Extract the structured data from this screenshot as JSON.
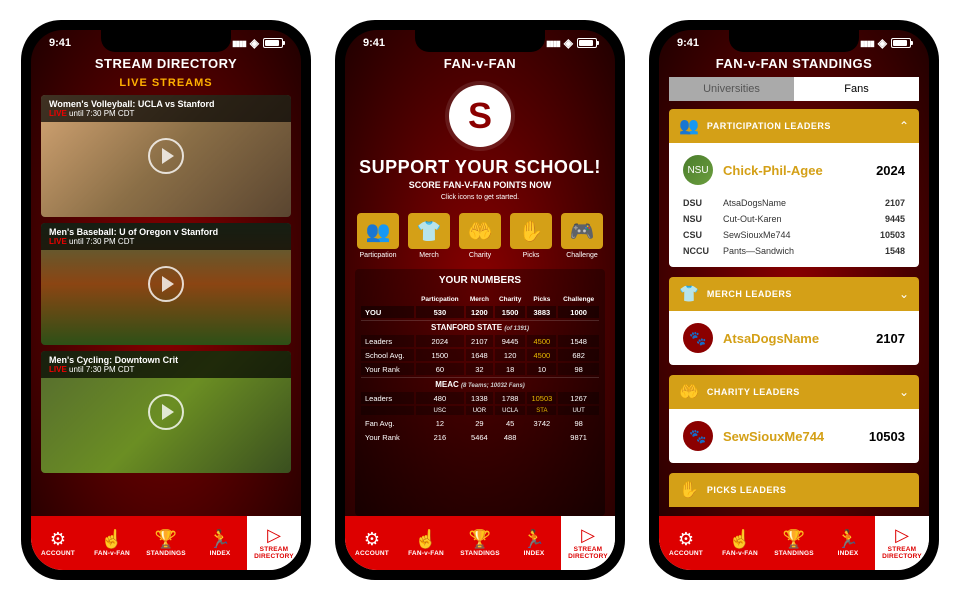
{
  "status": {
    "time": "9:41"
  },
  "nav": {
    "items": [
      {
        "label": "ACCOUNT",
        "icon": "⚙"
      },
      {
        "label": "FAN-v-FAN",
        "icon": "☝"
      },
      {
        "label": "STANDINGS",
        "icon": "🏆"
      },
      {
        "label": "INDEX",
        "icon": "🏃"
      },
      {
        "label": "STREAM\nDIRECTORY",
        "icon": "▷"
      }
    ]
  },
  "phone1": {
    "title": "STREAM DIRECTORY",
    "liveLabel": "LIVE STREAMS",
    "streams": [
      {
        "title": "Women's Volleyball: UCLA vs Stanford",
        "liveWord": "LIVE",
        "until": " until 7:30 PM CDT"
      },
      {
        "title": "Men's Baseball: U of Oregon v Stanford",
        "liveWord": "LIVE",
        "until": " until 7:30 PM CDT"
      },
      {
        "title": "Men's Cycling: Downtown Crit",
        "liveWord": "LIVE",
        "until": " until 7:30 PM CDT"
      }
    ]
  },
  "phone2": {
    "title": "FAN-v-FAN",
    "logoLetter": "S",
    "supportTitle": "SUPPORT YOUR SCHOOL!",
    "supportSub": "SCORE FAN-V-FAN POINTS NOW",
    "supportHint": "Click icons to get started.",
    "categories": [
      {
        "label": "Particpation",
        "icon": "👥"
      },
      {
        "label": "Merch",
        "icon": "👕"
      },
      {
        "label": "Charity",
        "icon": "🤲"
      },
      {
        "label": "Picks",
        "icon": "✋"
      },
      {
        "label": "Challenge",
        "icon": "🎮"
      }
    ],
    "numbersTitle": "YOUR NUMBERS",
    "headers": [
      "Particpation",
      "Merch",
      "Charity",
      "Picks",
      "Challenge"
    ],
    "youLabel": "YOU",
    "you": [
      "530",
      "1200",
      "1500",
      "3883",
      "1000"
    ],
    "stanfordLabel": "STANFORD STATE",
    "stanfordOf": "(of 1391)",
    "stanfordRows": [
      {
        "label": "Leaders",
        "vals": [
          "2024",
          "2107",
          "9445",
          "4500",
          "1548"
        ],
        "hl": 3
      },
      {
        "label": "School Avg.",
        "vals": [
          "1500",
          "1648",
          "120",
          "4500",
          "682"
        ],
        "hl": 3
      },
      {
        "label": "Your Rank",
        "vals": [
          "60",
          "32",
          "18",
          "10",
          "98"
        ]
      }
    ],
    "meacLabel": "MEAC",
    "meacOf": "(8 Teams; 10032 Fans)",
    "meacRows": [
      {
        "label": "Leaders",
        "vals": [
          "480",
          "1338",
          "1788",
          "10503",
          "1267"
        ],
        "subs": [
          "USC",
          "UOR",
          "UCLA",
          "STA",
          "UUT"
        ],
        "hl": 3
      },
      {
        "label": "Fan Avg.",
        "vals": [
          "12",
          "29",
          "45",
          "3742",
          "98"
        ]
      },
      {
        "label": "Your Rank",
        "vals": [
          "216",
          "5464",
          "488",
          "",
          "9871"
        ]
      }
    ]
  },
  "phone3": {
    "title": "FAN-v-FAN STANDINGS",
    "tabs": [
      "Universities",
      "Fans"
    ],
    "activeTab": 1,
    "sections": [
      {
        "icon": "👥",
        "title": "PARTICIPATION LEADERS",
        "expanded": true,
        "top": {
          "name": "Chick-Phil-Agee",
          "score": "2024",
          "avatar": "NSU"
        },
        "rows": [
          {
            "code": "DSU",
            "name": "AtsaDogsName",
            "score": "2107"
          },
          {
            "code": "NSU",
            "name": "Cut-Out-Karen",
            "score": "9445"
          },
          {
            "code": "CSU",
            "name": "SewSiouxMe744",
            "score": "10503"
          },
          {
            "code": "NCCU",
            "name": "Pants—Sandwich",
            "score": "1548"
          }
        ]
      },
      {
        "icon": "👕",
        "title": "MERCH LEADERS",
        "top": {
          "name": "AtsaDogsName",
          "score": "2107"
        }
      },
      {
        "icon": "🤲",
        "title": "CHARITY LEADERS",
        "top": {
          "name": "SewSiouxMe744",
          "score": "10503"
        }
      },
      {
        "icon": "✋",
        "title": "PICKS LEADERS"
      }
    ]
  }
}
